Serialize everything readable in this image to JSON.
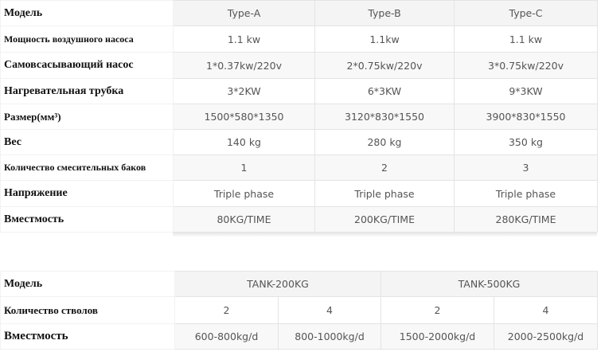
{
  "table1": {
    "header": {
      "label": "Модель",
      "cols": [
        "Type-A",
        "Type-B",
        "Type-C"
      ]
    },
    "rows": [
      {
        "label": "Мощность воздушного насоса",
        "values": [
          "1.1 kw",
          "1.1kw",
          "1.1 kw"
        ]
      },
      {
        "label": "Самовсасывающий насос",
        "values": [
          "1*0.37kw/220v",
          "2*0.75kw/220v",
          "3*0.75kw/220v"
        ]
      },
      {
        "label": "Нагревательная трубка",
        "values": [
          "3*2KW",
          "6*3KW",
          "9*3KW"
        ]
      },
      {
        "label": "Размер(мм³)",
        "values": [
          "1500*580*1350",
          "3120*830*1550",
          "3900*830*1550"
        ]
      },
      {
        "label": "Вес",
        "values": [
          "140 kg",
          "280 kg",
          "350 kg"
        ]
      },
      {
        "label": "Количество смесительных баков",
        "values": [
          "1",
          "2",
          "3"
        ]
      },
      {
        "label": "Напряжение",
        "values": [
          "Triple phase",
          "Triple phase",
          "Triple phase"
        ]
      },
      {
        "label": "Вместмость",
        "values": [
          "80KG/TIME",
          "200KG/TIME",
          "280KG/TIME"
        ]
      }
    ]
  },
  "table2": {
    "header": {
      "label": "Модель",
      "cols": [
        "TANK-200KG",
        "TANK-500KG"
      ]
    },
    "rows": [
      {
        "label": "Количество стволов",
        "values": [
          "2",
          "4",
          "2",
          "4"
        ]
      },
      {
        "label": "Вместмость",
        "values": [
          "600-800kg/d",
          "800-1000kg/d",
          "1500-2000kg/d",
          "2000-2500kg/d"
        ]
      }
    ]
  }
}
